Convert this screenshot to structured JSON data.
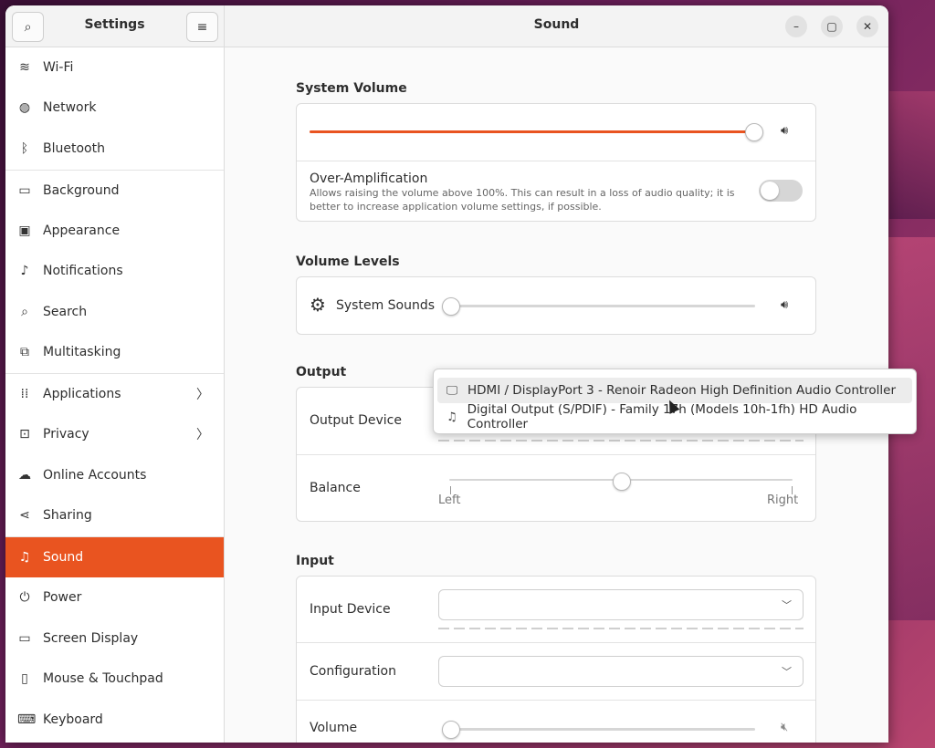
{
  "sidebar": {
    "title": "Settings",
    "items": [
      {
        "label": "Wi-Fi",
        "icon": "≋"
      },
      {
        "label": "Network",
        "icon": "◍"
      },
      {
        "label": "Bluetooth",
        "icon": "ᛒ"
      },
      {
        "label": "Background",
        "icon": "▭"
      },
      {
        "label": "Appearance",
        "icon": "▣"
      },
      {
        "label": "Notifications",
        "icon": "♫"
      },
      {
        "label": "Search",
        "icon": "⌕"
      },
      {
        "label": "Multitasking",
        "icon": "⧉"
      },
      {
        "label": "Applications",
        "icon": "⋮⋮"
      },
      {
        "label": "Privacy",
        "icon": "⊡"
      },
      {
        "label": "Online Accounts",
        "icon": "☁"
      },
      {
        "label": "Sharing",
        "icon": "⋖"
      },
      {
        "label": "Sound",
        "icon": "♫"
      },
      {
        "label": "Power",
        "icon": "⏻"
      },
      {
        "label": "Screen Display",
        "icon": "▭"
      },
      {
        "label": "Mouse & Touchpad",
        "icon": "◯"
      },
      {
        "label": "Keyboard",
        "icon": "⌨"
      }
    ]
  },
  "main": {
    "title": "Sound",
    "system_volume": {
      "title": "System Volume",
      "level_percent": 100,
      "over_amp_label": "Over-Amplification",
      "over_amp_desc_1": "Allows raising the volume above 100%. This can result in a loss of audio quality; it is",
      "over_amp_desc_2": "better to increase application volume settings, if possible.",
      "over_amp_enabled": false
    },
    "volume_levels": {
      "title": "Volume Levels",
      "system_sounds_label": "System Sounds",
      "system_sounds_level_percent": 0
    },
    "output": {
      "title": "Output",
      "device_label": "Output Device",
      "balance_label": "Balance",
      "balance_left": "Left",
      "balance_right": "Right",
      "balance_position_percent": 50
    },
    "input": {
      "title": "Input",
      "device_label": "Input Device",
      "config_label": "Configuration",
      "volume_label": "Volume",
      "volume_level_percent": 0
    }
  },
  "popup": {
    "options": [
      {
        "label": "HDMI / DisplayPort 3 - Renoir Radeon High Definition Audio Controller",
        "icon": "monitor-icon"
      },
      {
        "label": "Digital Output (S/PDIF) - Family 17h (Models 10h-1fh) HD Audio Controller",
        "icon": "music-file-icon"
      }
    ]
  },
  "colors": {
    "accent": "#e95420"
  }
}
